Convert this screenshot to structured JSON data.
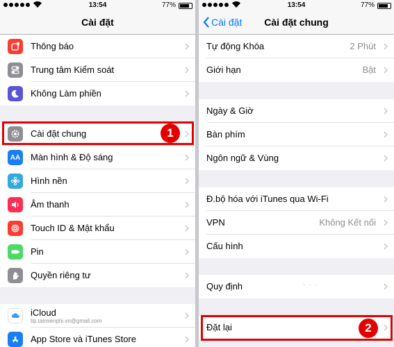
{
  "status": {
    "time": "13:54",
    "battery": "77%"
  },
  "left": {
    "title": "Cài đặt",
    "items": [
      {
        "label": "Thông báo",
        "icon": "notifications-icon",
        "color": "#fe3b30"
      },
      {
        "label": "Trung tâm Kiểm soát",
        "icon": "control-center-icon",
        "color": "#8e8e93"
      },
      {
        "label": "Không Làm phiền",
        "icon": "moon-icon",
        "color": "#5856d6"
      },
      {
        "label": "Cài đặt chung",
        "icon": "gear-icon",
        "color": "#8e8e93"
      },
      {
        "label": "Màn hình & Độ sáng",
        "icon": "display-brightness-icon",
        "color": "#1a7ef5"
      },
      {
        "label": "Hình nền",
        "icon": "wallpaper-icon",
        "color": "#34aadc"
      },
      {
        "label": "Âm thanh",
        "icon": "sound-icon",
        "color": "#fe2d55"
      },
      {
        "label": "Touch ID & Mật khẩu",
        "icon": "fingerprint-icon",
        "color": "#fe3b30"
      },
      {
        "label": "Pin",
        "icon": "battery-icon",
        "color": "#4cd964"
      },
      {
        "label": "Quyền riêng tư",
        "icon": "privacy-hand-icon",
        "color": "#8e8e93"
      },
      {
        "label": "iCloud",
        "sub": "tip.taimienphi.vn@gmail.com",
        "icon": "icloud-icon",
        "color": "#ffffff"
      },
      {
        "label": "App Store và iTunes Store",
        "icon": "app-store-icon",
        "color": "#1a7ef5"
      }
    ],
    "badge": "1"
  },
  "right": {
    "back_label": "Cài đặt",
    "title": "Cài đặt chung",
    "items": [
      {
        "label": "Tự động Khóa",
        "value": "2 Phút"
      },
      {
        "label": "Giới hạn",
        "value": "Bật"
      },
      {
        "label": "Ngày & Giờ",
        "value": ""
      },
      {
        "label": "Bàn phím",
        "value": ""
      },
      {
        "label": "Ngôn ngữ & Vùng",
        "value": ""
      },
      {
        "label": "Đ.bộ hóa với iTunes qua Wi-Fi",
        "value": ""
      },
      {
        "label": "VPN",
        "value": "Không Kết nối"
      },
      {
        "label": "Cấu hình",
        "value": ""
      },
      {
        "label": "Quy định",
        "value": ""
      },
      {
        "label": "Đặt lại",
        "value": ""
      }
    ],
    "badge": "2"
  },
  "colors": {
    "highlight": "#e30000",
    "accent": "#007aff"
  }
}
